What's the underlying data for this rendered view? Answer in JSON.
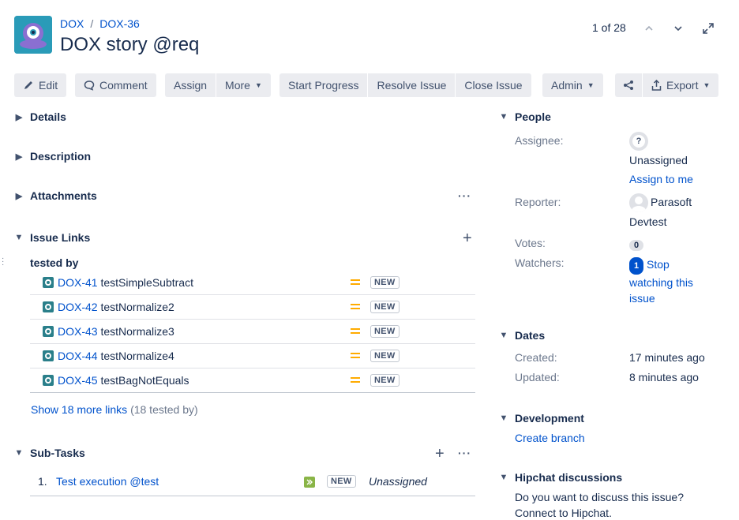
{
  "breadcrumb": {
    "project": "DOX",
    "issue_key": "DOX-36"
  },
  "issue": {
    "title": "DOX story @req"
  },
  "pager": {
    "text": "1 of 28"
  },
  "toolbar": {
    "edit": "Edit",
    "comment": "Comment",
    "assign": "Assign",
    "more": "More",
    "start_progress": "Start Progress",
    "resolve_issue": "Resolve Issue",
    "close_issue": "Close Issue",
    "admin": "Admin",
    "export": "Export"
  },
  "sections": {
    "details": "Details",
    "description": "Description",
    "attachments": "Attachments",
    "issue_links": "Issue Links",
    "sub_tasks": "Sub-Tasks"
  },
  "issue_links": {
    "group_label": "tested by",
    "links": [
      {
        "key": "DOX-41",
        "summary": "testSimpleSubtract",
        "status": "NEW"
      },
      {
        "key": "DOX-42",
        "summary": "testNormalize2",
        "status": "NEW"
      },
      {
        "key": "DOX-43",
        "summary": "testNormalize3",
        "status": "NEW"
      },
      {
        "key": "DOX-44",
        "summary": "testNormalize4",
        "status": "NEW"
      },
      {
        "key": "DOX-45",
        "summary": "testBagNotEquals",
        "status": "NEW"
      }
    ],
    "show_more": "Show 18 more links",
    "show_more_note": "(18 tested by)"
  },
  "sub_tasks": [
    {
      "index": "1.",
      "summary": "Test execution @test",
      "status": "NEW",
      "assignee": "Unassigned"
    }
  ],
  "people": {
    "title": "People",
    "assignee_label": "Assignee:",
    "assignee_value": "Unassigned",
    "assign_to_me": "Assign to me",
    "reporter_label": "Reporter:",
    "reporter_value_line1": "Parasoft",
    "reporter_value_line2": "Devtest",
    "votes_label": "Votes:",
    "votes_count": "0",
    "watchers_label": "Watchers:",
    "watchers_count": "1",
    "stop_watching_line1": "Stop",
    "stop_watching_line2": "watching this",
    "stop_watching_line3": "issue"
  },
  "dates": {
    "title": "Dates",
    "created_label": "Created:",
    "created_value": "17 minutes ago",
    "updated_label": "Updated:",
    "updated_value": "8 minutes ago"
  },
  "development": {
    "title": "Development",
    "create_branch": "Create branch"
  },
  "hipchat": {
    "title": "Hipchat discussions",
    "line1": "Do you want to discuss this issue?",
    "line2": "Connect to Hipchat."
  },
  "colors": {
    "link": "#0052cc",
    "text": "#172b4d",
    "button_bg": "#ebecf0",
    "priority": "#ffab00",
    "project_avatar": "#2a9bb8"
  }
}
